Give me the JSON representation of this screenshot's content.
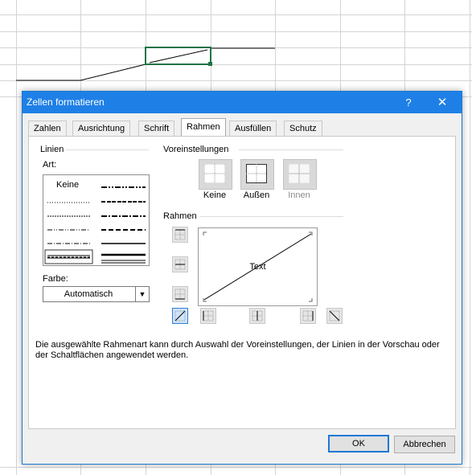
{
  "dialog": {
    "title": "Zellen formatieren",
    "help_label": "?",
    "close_label": "✕",
    "tabs": [
      "Zahlen",
      "Ausrichtung",
      "Schrift",
      "Rahmen",
      "Ausfüllen",
      "Schutz"
    ],
    "active_tab": "Rahmen"
  },
  "lines": {
    "group_label": "Linien",
    "art_label": "Art:",
    "none_label": "Keine",
    "color_label": "Farbe:",
    "color_value": "Automatisch"
  },
  "presets": {
    "group_label": "Voreinstellungen",
    "items": [
      "Keine",
      "Außen",
      "Innen"
    ]
  },
  "border": {
    "group_label": "Rahmen",
    "preview_text": "Text"
  },
  "description": "Die ausgewählte Rahmenart kann durch Auswahl der Voreinstellungen, der Linien in der Vorschau oder der Schaltflächen angewendet werden.",
  "buttons": {
    "ok": "OK",
    "cancel": "Abbrechen"
  },
  "colors": {
    "titlebar": "#1e80e6",
    "selection_border": "#217346",
    "accent": "#1f78d6"
  }
}
